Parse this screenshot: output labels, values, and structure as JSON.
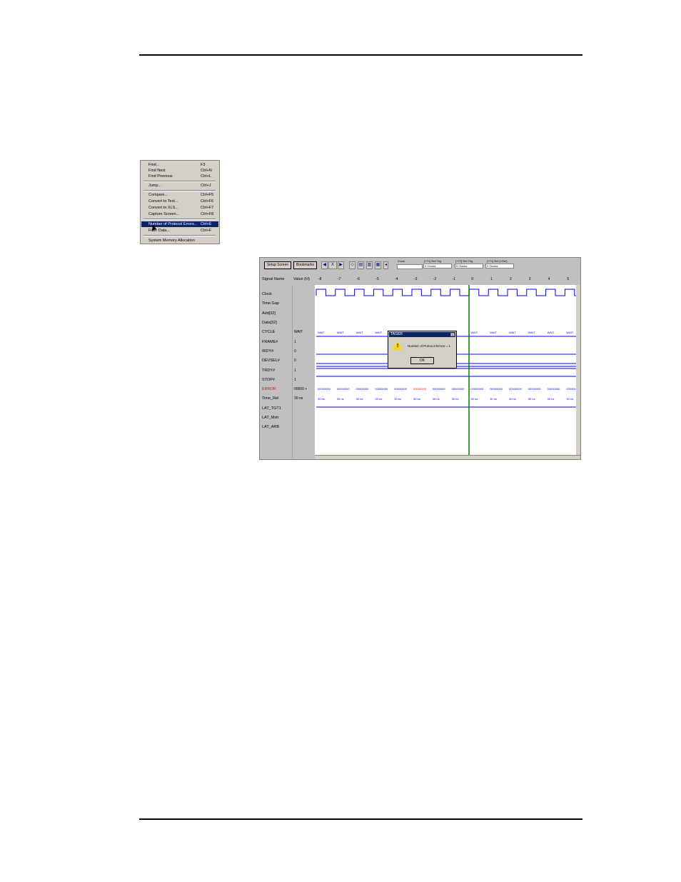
{
  "menu": {
    "items": [
      {
        "label": "Find...",
        "shortcut": "F3"
      },
      {
        "label": "Find Next",
        "shortcut": "Ctrl+N"
      },
      {
        "label": "Find Previous",
        "shortcut": "Ctrl+L"
      },
      {
        "label": "Jump...",
        "shortcut": "Ctrl+J"
      },
      {
        "label": "Compare...",
        "shortcut": "Ctrl+F5"
      },
      {
        "label": "Convert to Text...",
        "shortcut": "Ctrl+F6"
      },
      {
        "label": "Convert to XLS...",
        "shortcut": "Ctrl+F7"
      },
      {
        "label": "Capture Screen...",
        "shortcut": "Ctrl+F8"
      },
      {
        "label": "Number of Protocol Errors...",
        "shortcut": "Ctrl+E"
      },
      {
        "label": "Filter Data...",
        "shortcut": "Ctrl+F"
      },
      {
        "label": "System Memory Allocation",
        "shortcut": ""
      }
    ]
  },
  "toolbar": {
    "setup_screen": "Setup Screen",
    "bookmarks": "Bookmarks",
    "zoom_label": "Zoom",
    "x_label": "X",
    "t1_label": "[+T1] Ref Trig",
    "t1_value": "0 Clocks",
    "t2_label": "[+T2] Ref Trig",
    "t2_value": "0 Clocks",
    "t3_label": "[+T1] Ref [+Ref]",
    "t3_value": "0 Clocks"
  },
  "headers": {
    "signal": "Signal Name",
    "value": "Value (H)"
  },
  "ticks": [
    "-8",
    "-7",
    "-6",
    "-5",
    "-4",
    "-3",
    "-2",
    "-1",
    "0",
    "1",
    "2",
    "3",
    "4",
    "5"
  ],
  "signals": [
    {
      "name": "Clock",
      "value": ""
    },
    {
      "name": "Time Gap",
      "value": ""
    },
    {
      "name": "Add[32]",
      "value": ""
    },
    {
      "name": "Data[32]",
      "value": ""
    },
    {
      "name": "CYCLE",
      "value": "WAIT"
    },
    {
      "name": "FRAME#",
      "value": "1"
    },
    {
      "name": "IRDY#",
      "value": "0"
    },
    {
      "name": "DEVSEL#",
      "value": "0"
    },
    {
      "name": "TRDY#",
      "value": "1"
    },
    {
      "name": "STOP#",
      "value": "1"
    },
    {
      "name": "ERROR",
      "value": "00000 +"
    },
    {
      "name": "Time_Rel",
      "value": "30 ns"
    },
    {
      "name": "LAT_TGT1",
      "value": ""
    },
    {
      "name": "LAT_Mstr",
      "value": ""
    },
    {
      "name": "LAT_ARB",
      "value": ""
    }
  ],
  "cells": {
    "wait": "WAIT",
    "error": "00000000",
    "time": "30 ns"
  },
  "dialog": {
    "title": "TAGER",
    "message": "Number of Protocol Errors = 1",
    "ok": "OK",
    "icon": "warning-icon"
  },
  "colors": {
    "highlight": "#0a246a",
    "wave": "#0000ff",
    "error": "#ff0000",
    "cursor": "#008000"
  }
}
